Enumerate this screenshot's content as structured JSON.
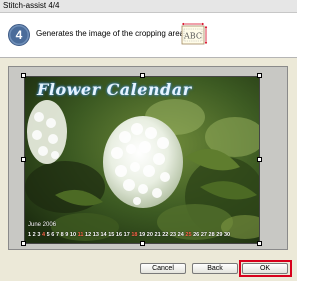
{
  "window": {
    "title": "Stitch-assist 4/4"
  },
  "header": {
    "step_number": "4",
    "instruction": "Generates the image of the cropping areas.",
    "abc_icon_text": "ABC"
  },
  "preview": {
    "calendar_title": "Flower Calendar",
    "month_label": "June 2006",
    "days": [
      {
        "text": "1",
        "color": "#ffffff"
      },
      {
        "text": "2",
        "color": "#ffffff"
      },
      {
        "text": "3",
        "color": "#ffffff"
      },
      {
        "text": "4",
        "color": "#ff6a4a"
      },
      {
        "text": "5",
        "color": "#ffffff"
      },
      {
        "text": "6",
        "color": "#ffffff"
      },
      {
        "text": "7",
        "color": "#ffffff"
      },
      {
        "text": "8",
        "color": "#ffffff"
      },
      {
        "text": "9",
        "color": "#ffffff"
      },
      {
        "text": "10",
        "color": "#ffffff"
      },
      {
        "text": "11",
        "color": "#ff6a4a"
      },
      {
        "text": "12",
        "color": "#ffffff"
      },
      {
        "text": "13",
        "color": "#ffffff"
      },
      {
        "text": "14",
        "color": "#ffffff"
      },
      {
        "text": "15",
        "color": "#ffffff"
      },
      {
        "text": "16",
        "color": "#ffffff"
      },
      {
        "text": "17",
        "color": "#ffffff"
      },
      {
        "text": "18",
        "color": "#ff6a4a"
      },
      {
        "text": "19",
        "color": "#ffffff"
      },
      {
        "text": "20",
        "color": "#ffffff"
      },
      {
        "text": "21",
        "color": "#ffffff"
      },
      {
        "text": "22",
        "color": "#ffffff"
      },
      {
        "text": "23",
        "color": "#ffffff"
      },
      {
        "text": "24",
        "color": "#ffffff"
      },
      {
        "text": "25",
        "color": "#ff6a4a"
      },
      {
        "text": "26",
        "color": "#ffffff"
      },
      {
        "text": "27",
        "color": "#ffffff"
      },
      {
        "text": "28",
        "color": "#ffffff"
      },
      {
        "text": "29",
        "color": "#ffffff"
      },
      {
        "text": "30",
        "color": "#ffffff"
      }
    ]
  },
  "buttons": {
    "cancel": "Cancel",
    "back": "Back",
    "ok": "OK"
  },
  "colors": {
    "highlight": "#d7001c",
    "step_badge": "#4a6c9a",
    "calendar_title": "#e6f4ff"
  }
}
